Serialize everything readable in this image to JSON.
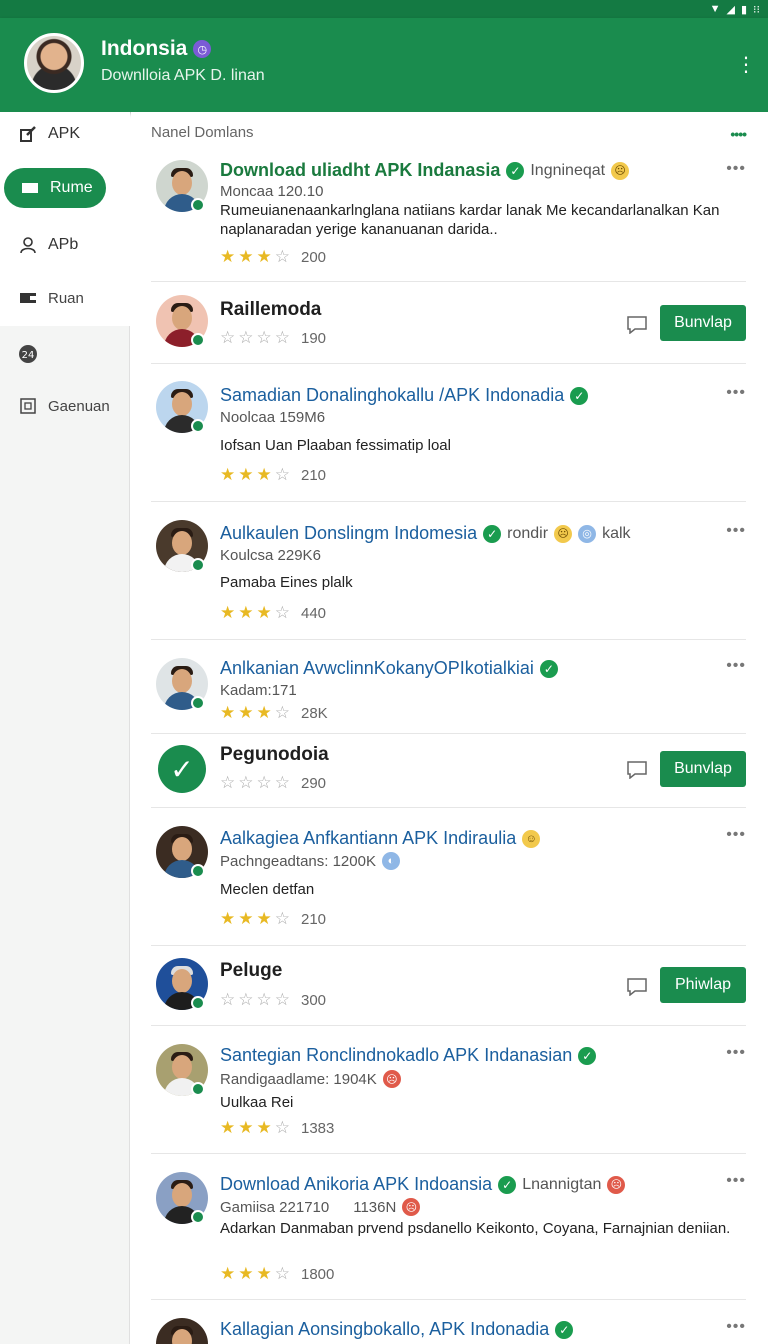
{
  "app": {
    "title": "Indonsia",
    "title_badge": "◷",
    "subtitle": "Downlloia APK D. linan"
  },
  "status": {
    "right": "⁝⁝"
  },
  "sidebar": {
    "items": [
      {
        "label": "APK",
        "icon": "edit-icon"
      },
      {
        "label": "Rume",
        "icon": "card-icon",
        "active": true
      },
      {
        "label": "APb",
        "icon": "person-icon"
      },
      {
        "label": "Ruan",
        "icon": "wallet-icon"
      },
      {
        "label": "",
        "icon": "badge-icon"
      },
      {
        "label": "Gaenuan",
        "icon": "document-icon"
      }
    ]
  },
  "main": {
    "header": "Nanel Domlans",
    "header_dots": "••••",
    "items": [
      {
        "title": "Download uliadht APK Indanasia",
        "extra": "Ingnineqat",
        "meta": "Moncaa 120.10",
        "desc": "Rumeuianenaankarlnglana natiians kardar lanak Me kecandarlanalkan Kan naplanaradan yerige kananuanan darida..",
        "rating": "200"
      },
      {
        "title": "Raillemoda",
        "rating": "190",
        "button": "Bunvlap"
      },
      {
        "title": "Samadian Donalinghokallu /APK Indonadia",
        "meta": "Noolcaa 159M6",
        "desc": "Iofsan Uan Plaaban fessimatip loal",
        "rating": "210"
      },
      {
        "title": "Aulkaulen Donslingm Indomesia",
        "extra": "rondir",
        "extra2": "kalk",
        "meta": "Koulcsa 229K6",
        "desc": "Pamaba Eines plalk",
        "rating": "440"
      },
      {
        "title": "Anlkanian AvwclinnKokanyOPIkotialkiai",
        "meta": "Kadam:171",
        "rating": "28K"
      },
      {
        "title": "Pegunodoia",
        "rating": "290",
        "button": "Bunvlap"
      },
      {
        "title": "Aalkagiea Anfkantiann APK Indiraulia",
        "meta": "Pachngeadtans: 1200K",
        "desc": "Meclen detfan",
        "rating": "210"
      },
      {
        "title": "Peluge",
        "rating": "300",
        "button": "Phiwlap"
      },
      {
        "title": "Santegian Ronclindnokadlo APK Indanasian",
        "meta": "Randigaadlame: 1904K",
        "desc": "Uulkaa Rei",
        "rating": "1383"
      },
      {
        "title": "Download Anikoria APK Indoansia",
        "extra": "Lnannigtan",
        "meta": "Gamiisa 221710",
        "meta2": "1136N",
        "desc": "Adarkan Danmaban prvend psdanello Keikonto, Coyana,  Farnajnian deniian.",
        "rating": "1800"
      },
      {
        "title": "Kallagian Aonsingbokallo, APK Indonadia"
      }
    ]
  },
  "icons": {
    "more": "•••",
    "verified": "✓",
    "star_on": "★",
    "star_off": "☆"
  },
  "colors": {
    "primary": "#1a8c4e",
    "status_bar": "#147a43",
    "link_blue": "#1b5f9e",
    "star": "#e8b923"
  }
}
